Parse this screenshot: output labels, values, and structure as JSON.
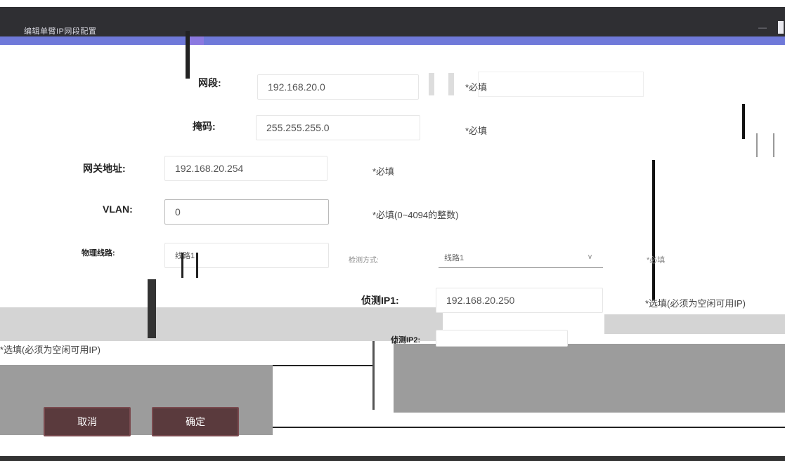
{
  "window": {
    "title": "编辑单臂IP网段配置",
    "close_label": "—"
  },
  "form": {
    "segment": {
      "label": "网段:",
      "value": "192.168.20.0",
      "hint": "*必填"
    },
    "mask": {
      "label": "掩码:",
      "value": "255.255.255.0",
      "hint": "*必填"
    },
    "gateway": {
      "label": "网关地址:",
      "value": "192.168.20.254",
      "hint": "*必填"
    },
    "vlan": {
      "label": "VLAN:",
      "value": "0",
      "hint": "*必填(0~4094的整数)"
    },
    "physical_line": {
      "label": "物理线路:",
      "value": "线路1"
    },
    "detect_mode": {
      "label": "检测方式:",
      "value": "线路1",
      "hint": "*必填"
    },
    "detect_ip1": {
      "label": "侦测IP1:",
      "value": "192.168.20.250",
      "hint": "*选填(必须为空闲可用IP)"
    },
    "detect_ip2": {
      "label": "侦测IP2:",
      "value": "",
      "hint": "*选填(必须为空闲可用IP)"
    }
  },
  "buttons": {
    "cancel": "取消",
    "confirm": "确定"
  },
  "colors": {
    "accent": "#6f79d9",
    "titlebar": "#2f2f33",
    "button": "#5a3a3d"
  }
}
